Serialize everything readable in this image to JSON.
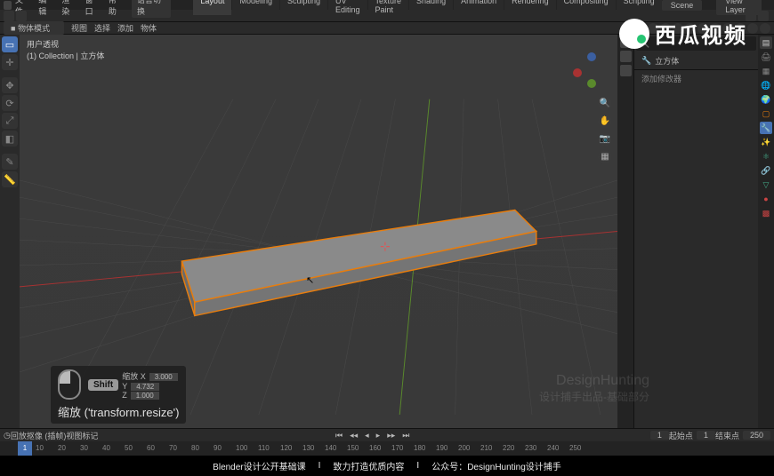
{
  "menu": {
    "file": "文件",
    "edit": "编辑",
    "render": "渲染",
    "window": "窗口",
    "help": "帮助",
    "group_btn": "语言切换"
  },
  "workspaces": [
    "Layout",
    "Modeling",
    "Sculpting",
    "UV Editing",
    "Texture Paint",
    "Shading",
    "Animation",
    "Rendering",
    "Compositing",
    "Scripting"
  ],
  "top_right": {
    "scene": "Scene",
    "view_layer": "View Layer"
  },
  "mode": {
    "name": "物体模式",
    "menu_view": "视图",
    "menu_select": "选择",
    "menu_add": "添加",
    "menu_object": "物体"
  },
  "header": {
    "line1": "用户透视",
    "line2": "(1) Collection | 立方体"
  },
  "operator": {
    "key": "Shift",
    "x_label": "缩放 X",
    "x_val": "3.000",
    "y_label": "Y",
    "y_val": "4.732",
    "z_label": "Z",
    "z_val": "1.000",
    "title": "缩放 ('transform.resize')"
  },
  "timeline": {
    "playback": "回放",
    "keying": "抠像 (插帧)",
    "view": "视图",
    "marker": "标记",
    "current": "1",
    "start_label": "起始点",
    "start": "1",
    "end_label": "结束点",
    "end": "250",
    "ticks": [
      10,
      20,
      30,
      40,
      50,
      60,
      70,
      80,
      90,
      100,
      110,
      120,
      130,
      140,
      150,
      160,
      170,
      180,
      190,
      200,
      210,
      220,
      230,
      240,
      250
    ]
  },
  "props": {
    "search_placeholder": "🔍",
    "object_name": "立方体",
    "modifier_add": "添加修改器"
  },
  "subtitle": {
    "s1": "Blender设计公开基础课",
    "s2": "致力打造优质内容",
    "s3": "公众号：DesignHunting设计捕手"
  },
  "watermark": {
    "text": "西瓜视频",
    "wm2a": "DesignHunting",
    "wm2b": "设计捕手出品-基础部分"
  },
  "colors": {
    "accent": "#4772b3",
    "axis_x": "#a83232",
    "axis_y": "#5a8a2c",
    "axis_z": "#3b5fa0",
    "selection": "#e87d0d"
  }
}
